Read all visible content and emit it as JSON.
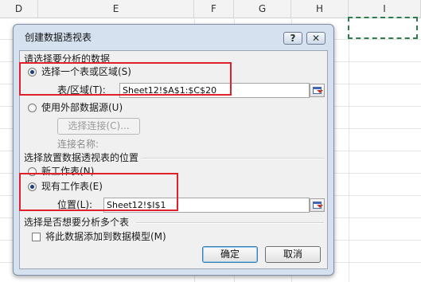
{
  "spreadsheet": {
    "columns": [
      "D",
      "E",
      "F",
      "G",
      "H",
      "I"
    ]
  },
  "dialog": {
    "title": "创建数据透视表",
    "help_glyph": "?",
    "close_glyph": "✕",
    "section1_label": "请选择要分析的数据",
    "radio_select_range_label": "选择一个表或区域(S)",
    "table_range_label": "表/区域(T):",
    "table_range_value": "Sheet12!$A$1:$C$20",
    "radio_external_label": "使用外部数据源(U)",
    "choose_connection_label": "选择连接(C)...",
    "connection_name_label": "连接名称:",
    "section2_label": "选择放置数据透视表的位置",
    "radio_new_sheet_label": "新工作表(N)",
    "radio_existing_sheet_label": "现有工作表(E)",
    "location_label": "位置(L):",
    "location_value": "Sheet12!$I$1",
    "section3_label": "选择是否想要分析多个表",
    "add_to_model_label": "将此数据添加到数据模型(M)",
    "ok_label": "确定",
    "cancel_label": "取消"
  },
  "colors": {
    "highlight": "#e0202a",
    "marquee": "#2e7d4f",
    "dialog_frame": "#d6e1f0"
  }
}
